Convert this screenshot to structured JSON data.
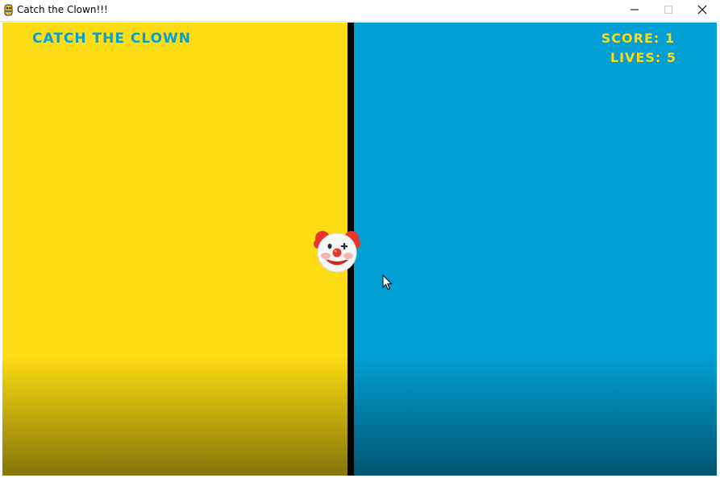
{
  "window": {
    "title": "Catch the Clown!!!",
    "icon": "pygame-snake-icon"
  },
  "controls": {
    "minimize_icon": "minimize-icon",
    "maximize_icon": "maximize-icon",
    "close_icon": "close-icon"
  },
  "game": {
    "title": "CATCH THE CLOWN",
    "score_label": "SCORE: 1",
    "lives_label": "LIVES: 5",
    "score": 1,
    "lives": 5,
    "sprite": "clown-face-icon",
    "colors": {
      "left_panel": "#fcdc12",
      "right_panel": "#019fd4",
      "divider": "#000000",
      "title_text": "#03a0d6",
      "hud_text": "#fcdc12"
    }
  }
}
